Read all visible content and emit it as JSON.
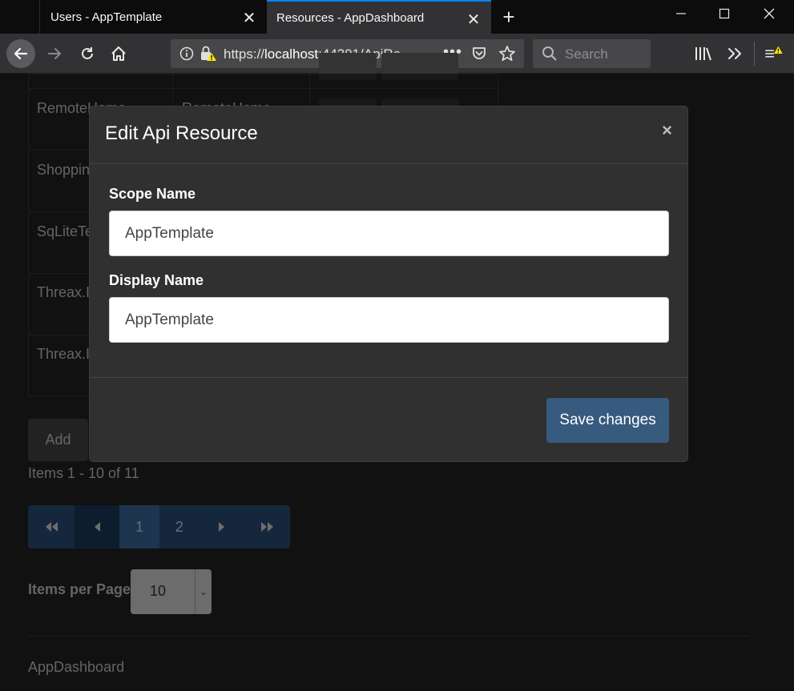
{
  "browser": {
    "tabs": [
      {
        "title": "Users - AppTemplate",
        "active": false
      },
      {
        "title": "Resources - AppDashboard",
        "active": true
      }
    ],
    "url_prefix": "https://",
    "url_host": "localhost",
    "url_rest": ":44391/ApiRe",
    "search_placeholder": "Search",
    "accent_color": "#0a84ff"
  },
  "page": {
    "table_rows": [
      {
        "name": "RemoteHome",
        "display": "RemoteHome"
      },
      {
        "name": "Shoppin",
        "display": ""
      },
      {
        "name": "SqLiteTe",
        "display": ""
      },
      {
        "name": "Threax.I",
        "display": ""
      },
      {
        "name": "Threax.I",
        "display": ""
      }
    ],
    "add_label": "Add",
    "items_summary": "Items 1 - 10 of 11",
    "pager": {
      "pages": [
        "1",
        "2"
      ],
      "current": "1"
    },
    "items_per_page_label": "Items per Page",
    "items_per_page_value": "10",
    "footer": "AppDashboard"
  },
  "modal": {
    "title": "Edit Api Resource",
    "close_glyph": "×",
    "fields": [
      {
        "label": "Scope Name",
        "value": "AppTemplate"
      },
      {
        "label": "Display Name",
        "value": "AppTemplate"
      }
    ],
    "save_label": "Save changes",
    "primary_color": "#375a7f"
  }
}
